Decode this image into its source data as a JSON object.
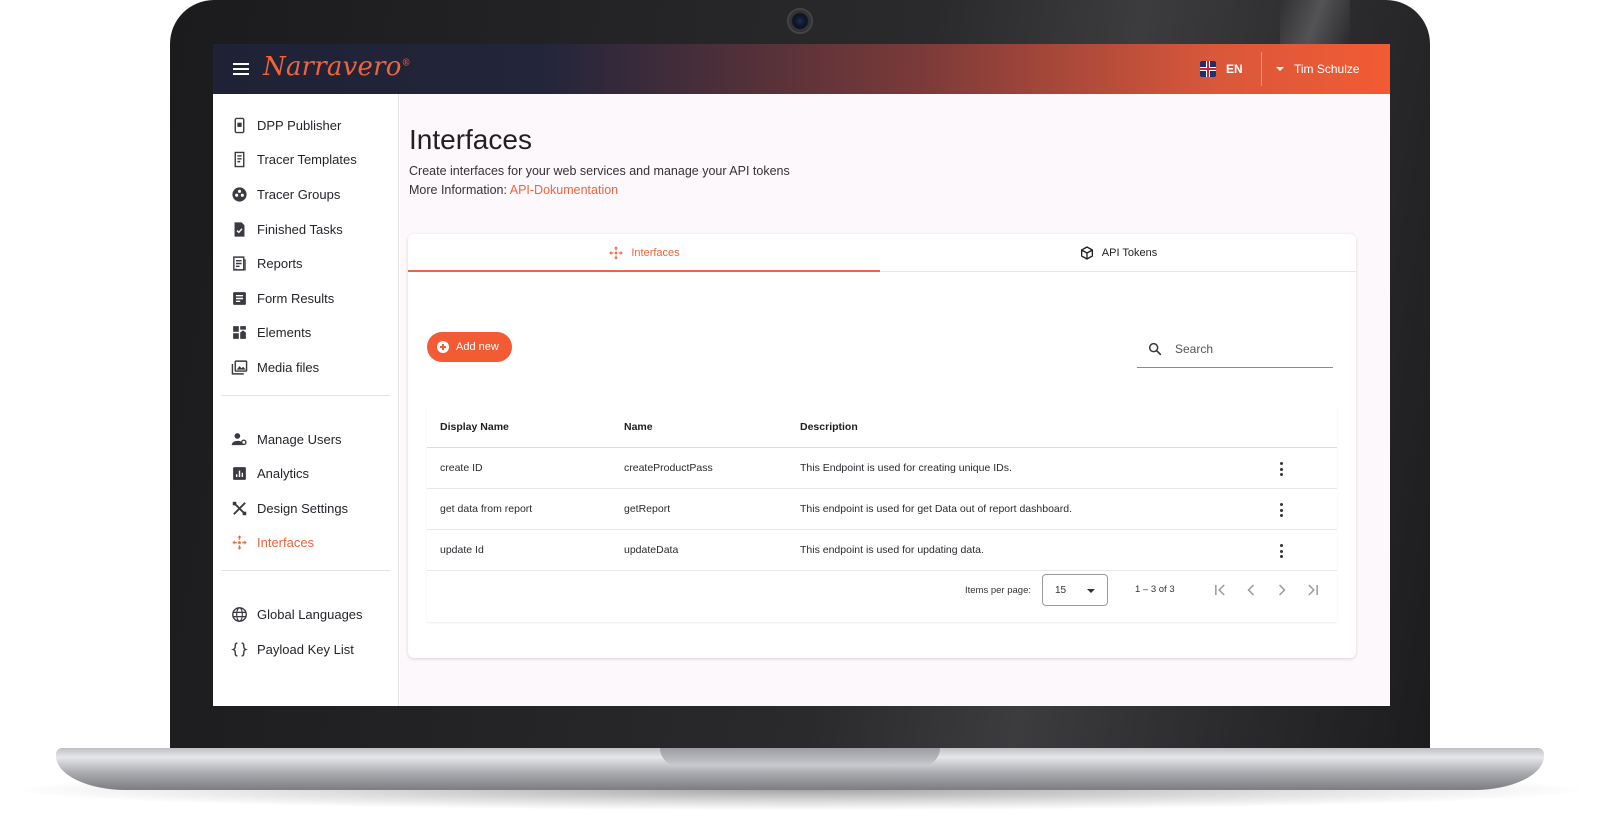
{
  "app": {
    "logo_text": "Narravero",
    "brand_color": "#f0643c"
  },
  "topbar": {
    "language": "EN",
    "user_name": "Tim Schulze"
  },
  "sidebar": {
    "groups": [
      [
        {
          "label": "DPP Publisher",
          "icon": "phone-icon"
        },
        {
          "label": "Tracer Templates",
          "icon": "document-icon"
        },
        {
          "label": "Tracer Groups",
          "icon": "group-circle-icon"
        },
        {
          "label": "Finished Tasks",
          "icon": "task-check-icon"
        },
        {
          "label": "Reports",
          "icon": "report-icon"
        },
        {
          "label": "Form Results",
          "icon": "form-icon"
        },
        {
          "label": "Elements",
          "icon": "dashboard-icon"
        },
        {
          "label": "Media files",
          "icon": "photo-library-icon"
        }
      ],
      [
        {
          "label": "Manage Users",
          "icon": "manage-users-icon"
        },
        {
          "label": "Analytics",
          "icon": "analytics-icon"
        },
        {
          "label": "Design Settings",
          "icon": "tools-icon"
        },
        {
          "label": "Interfaces",
          "icon": "interfaces-icon",
          "active": true
        }
      ],
      [
        {
          "label": "Global Languages",
          "icon": "globe-icon"
        },
        {
          "label": "Payload Key List",
          "icon": "braces-icon"
        }
      ]
    ]
  },
  "page": {
    "title": "Interfaces",
    "subtitle": "Create interfaces for your web services and manage your API tokens",
    "more_prefix": "More Information: ",
    "more_link": "API-Dokumentation"
  },
  "tabs": [
    {
      "label": "Interfaces",
      "icon": "interfaces-icon",
      "active": true
    },
    {
      "label": "API Tokens",
      "icon": "cube-icon",
      "active": false
    }
  ],
  "toolbar": {
    "add_label": "Add new",
    "search_placeholder": "Search"
  },
  "table": {
    "columns": [
      "Display Name",
      "Name",
      "Description"
    ],
    "rows": [
      {
        "display_name": "create ID",
        "name": "createProductPass",
        "description": "This Endpoint is used for creating unique IDs."
      },
      {
        "display_name": "get data from report",
        "name": "getReport",
        "description": "This endpoint is used for get Data out of report dashboard."
      },
      {
        "display_name": "update Id",
        "name": "updateData",
        "description": "This endpoint is used for updating data."
      }
    ]
  },
  "pagination": {
    "items_per_page_label": "Items per page:",
    "items_per_page": "15",
    "range": "1 – 3 of 3"
  }
}
